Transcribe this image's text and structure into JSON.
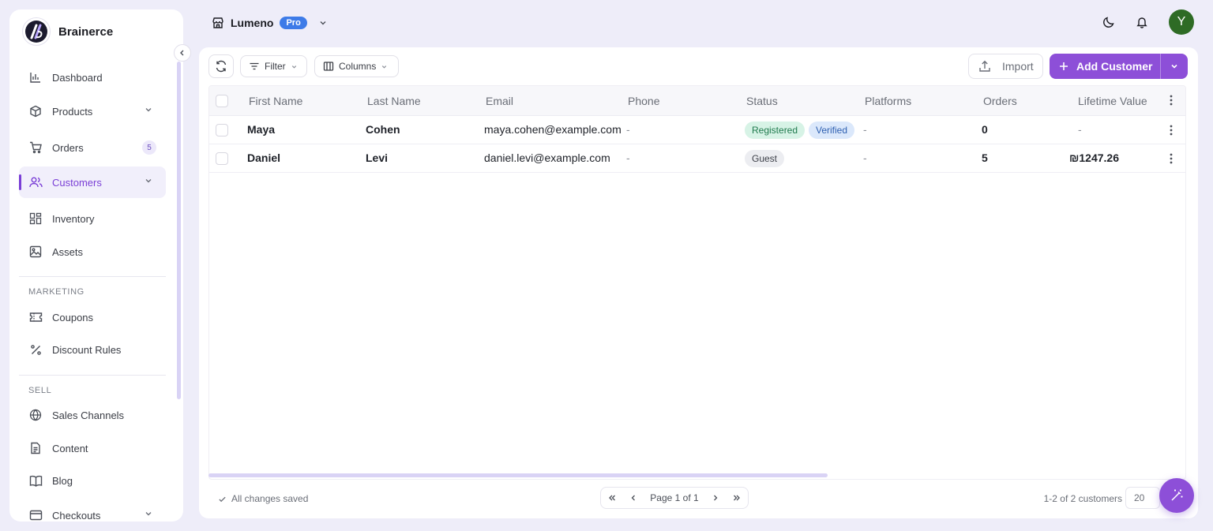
{
  "brand": {
    "name": "Brainerce",
    "logo_icon": "brand-logo-icon"
  },
  "sidebar": {
    "items": [
      {
        "label": "Dashboard",
        "icon": "bar-chart-icon"
      },
      {
        "label": "Products",
        "icon": "box-icon",
        "has_chevron": true
      },
      {
        "label": "Orders",
        "icon": "cart-icon",
        "badge": "5"
      },
      {
        "label": "Customers",
        "icon": "users-icon",
        "has_chevron": true,
        "active": true
      },
      {
        "label": "Inventory",
        "icon": "grid-icon"
      },
      {
        "label": "Assets",
        "icon": "image-icon"
      }
    ],
    "marketing_label": "MARKETING",
    "marketing_items": [
      {
        "label": "Coupons",
        "icon": "ticket-icon"
      },
      {
        "label": "Discount Rules",
        "icon": "percent-icon"
      }
    ],
    "sell_label": "SELL",
    "sell_items": [
      {
        "label": "Sales Channels",
        "icon": "globe-icon"
      },
      {
        "label": "Content",
        "icon": "document-icon"
      },
      {
        "label": "Blog",
        "icon": "book-icon"
      },
      {
        "label": "Checkouts",
        "icon": "card-icon",
        "has_chevron": true
      }
    ]
  },
  "header": {
    "store_name": "Lumeno",
    "plan_badge": "Pro",
    "avatar_initial": "Y"
  },
  "toolbar": {
    "filter_label": "Filter",
    "columns_label": "Columns",
    "import_label": "Import",
    "add_label": "Add Customer"
  },
  "table": {
    "columns": [
      "First Name",
      "Last Name",
      "Email",
      "Phone",
      "Status",
      "Platforms",
      "Orders",
      "Lifetime Value"
    ],
    "rows": [
      {
        "first_name": "Maya",
        "last_name": "Cohen",
        "email": "maya.cohen@example.com",
        "phone": "-",
        "status": [
          "Registered",
          "Verified"
        ],
        "platforms": "-",
        "orders": "0",
        "lifetime_value": "-"
      },
      {
        "first_name": "Daniel",
        "last_name": "Levi",
        "email": "daniel.levi@example.com",
        "phone": "-",
        "status": [
          "Guest"
        ],
        "platforms": "-",
        "orders": "5",
        "lifetime_value": "₪1247.26"
      }
    ]
  },
  "footer": {
    "saved_text": "All changes saved",
    "page_text": "Page 1 of 1",
    "count_text": "1-2 of 2 customers",
    "page_size": "20"
  },
  "colors": {
    "accent": "#8d4fd8",
    "background": "#eeedf9",
    "pro_badge": "#3d7be8",
    "avatar": "#2e6b25"
  }
}
